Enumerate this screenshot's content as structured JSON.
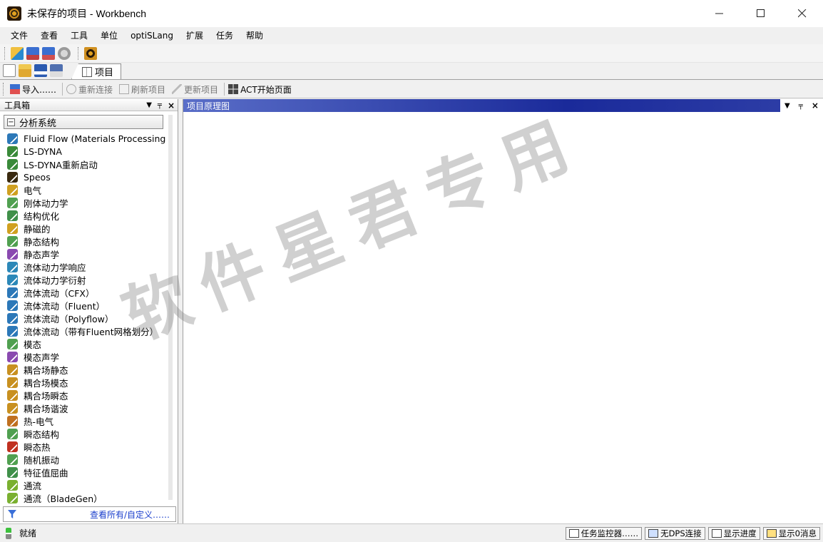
{
  "window": {
    "title": "未保存的项目 - Workbench"
  },
  "menu": [
    "文件",
    "查看",
    "工具",
    "单位",
    "optiSLang",
    "扩展",
    "任务",
    "帮助"
  ],
  "tabs": [
    {
      "label": "项目"
    }
  ],
  "toolbar2": {
    "import": "导入……",
    "reconnect": "重新连接",
    "refresh": "刷新项目",
    "update": "更新项目",
    "act": "ACT开始页面"
  },
  "toolbox": {
    "title": "工具箱",
    "group": "分析系统",
    "items": [
      {
        "label": "Fluid Flow (Materials Processing)",
        "icon": "fluid-flow-icon",
        "color": "#2c78b8"
      },
      {
        "label": "LS-DYNA",
        "icon": "ls-dyna-icon",
        "color": "#3a8a3a"
      },
      {
        "label": "LS-DYNA重新启动",
        "icon": "ls-dyna-restart-icon",
        "color": "#3a8a3a"
      },
      {
        "label": "Speos",
        "icon": "speos-icon",
        "color": "#3a2a10"
      },
      {
        "label": "电气",
        "icon": "electric-icon",
        "color": "#d0a020"
      },
      {
        "label": "刚体动力学",
        "icon": "rigid-dynamics-icon",
        "color": "#50a050"
      },
      {
        "label": "结构优化",
        "icon": "topology-optimization-icon",
        "color": "#40904a"
      },
      {
        "label": "静磁的",
        "icon": "magnetostatic-icon",
        "color": "#d0a020"
      },
      {
        "label": "静态结构",
        "icon": "static-structural-icon",
        "color": "#50a050"
      },
      {
        "label": "静态声学",
        "icon": "static-acoustics-icon",
        "color": "#8a4ab0"
      },
      {
        "label": "流体动力学响应",
        "icon": "hydrodynamic-response-icon",
        "color": "#2c88b8"
      },
      {
        "label": "流体动力学衍射",
        "icon": "hydrodynamic-diffraction-icon",
        "color": "#2c88b8"
      },
      {
        "label": "流体流动（CFX）",
        "icon": "cfx-icon",
        "color": "#2c78b8"
      },
      {
        "label": "流体流动（Fluent）",
        "icon": "fluent-icon",
        "color": "#2c78b8"
      },
      {
        "label": "流体流动（Polyflow）",
        "icon": "polyflow-icon",
        "color": "#2c78b8"
      },
      {
        "label": "流体流动（带有Fluent网格划分）",
        "icon": "fluent-meshing-icon",
        "color": "#2c78b8"
      },
      {
        "label": "模态",
        "icon": "modal-icon",
        "color": "#50a050"
      },
      {
        "label": "模态声学",
        "icon": "modal-acoustics-icon",
        "color": "#8a4ab0"
      },
      {
        "label": "耦合场静态",
        "icon": "coupled-static-icon",
        "color": "#c89020"
      },
      {
        "label": "耦合场模态",
        "icon": "coupled-modal-icon",
        "color": "#c89020"
      },
      {
        "label": "耦合场瞬态",
        "icon": "coupled-transient-icon",
        "color": "#c89020"
      },
      {
        "label": "耦合场谐波",
        "icon": "coupled-harmonic-icon",
        "color": "#c89020"
      },
      {
        "label": "热-电气",
        "icon": "thermal-electric-icon",
        "color": "#c07020"
      },
      {
        "label": "瞬态结构",
        "icon": "transient-structural-icon",
        "color": "#50a050"
      },
      {
        "label": "瞬态热",
        "icon": "transient-thermal-icon",
        "color": "#c03020"
      },
      {
        "label": "随机振动",
        "icon": "random-vibration-icon",
        "color": "#50a050"
      },
      {
        "label": "特征值屈曲",
        "icon": "eigenvalue-buckling-icon",
        "color": "#40904a"
      },
      {
        "label": "通流",
        "icon": "throughflow-icon",
        "color": "#7ab030"
      },
      {
        "label": "通流（BladeGen）",
        "icon": "throughflow-bladegen-icon",
        "color": "#7ab030"
      }
    ],
    "footer_link": "查看所有/自定义……"
  },
  "schematic": {
    "title": "项目原理图"
  },
  "watermark": "软件星君专用",
  "status": {
    "text": "就绪",
    "task_monitor": "任务监控器……",
    "no_dps": "无DPS连接",
    "show_progress": "显示进度",
    "messages": "显示0消息"
  }
}
